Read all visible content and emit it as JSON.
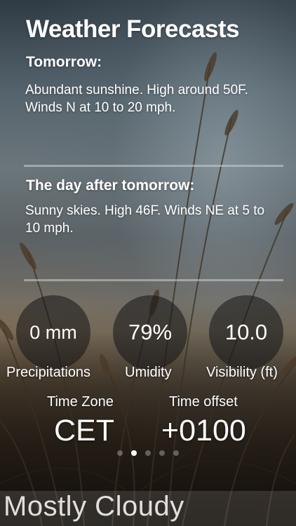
{
  "app": {
    "title": "Weather Forecasts"
  },
  "forecast": {
    "tomorrow": {
      "heading": "Tomorrow:",
      "text": "Abundant sunshine. High around 50F. Winds N at 10 to 20 mph."
    },
    "day_after": {
      "heading": "The day after tomorrow:",
      "text": "Sunny skies. High 46F. Winds NE at 5 to 10 mph."
    }
  },
  "stats": {
    "precipitation": {
      "value": "0 mm",
      "label": "Precipitations"
    },
    "humidity": {
      "value": "79%",
      "label": "Umidity"
    },
    "visibility": {
      "value": "10.0",
      "label": "Visibility (ft)"
    }
  },
  "time": {
    "zone_label": "Time Zone",
    "zone_value": "CET",
    "offset_label": "Time offset",
    "offset_value": "+0100"
  },
  "pager": {
    "count": 5,
    "active_index": 1
  },
  "current": {
    "condition": "Mostly Cloudy"
  },
  "colors": {
    "text": "#ffffff",
    "circle_bg": "rgba(20,20,22,0.55)",
    "divider": "rgba(205,210,212,0.55)"
  }
}
